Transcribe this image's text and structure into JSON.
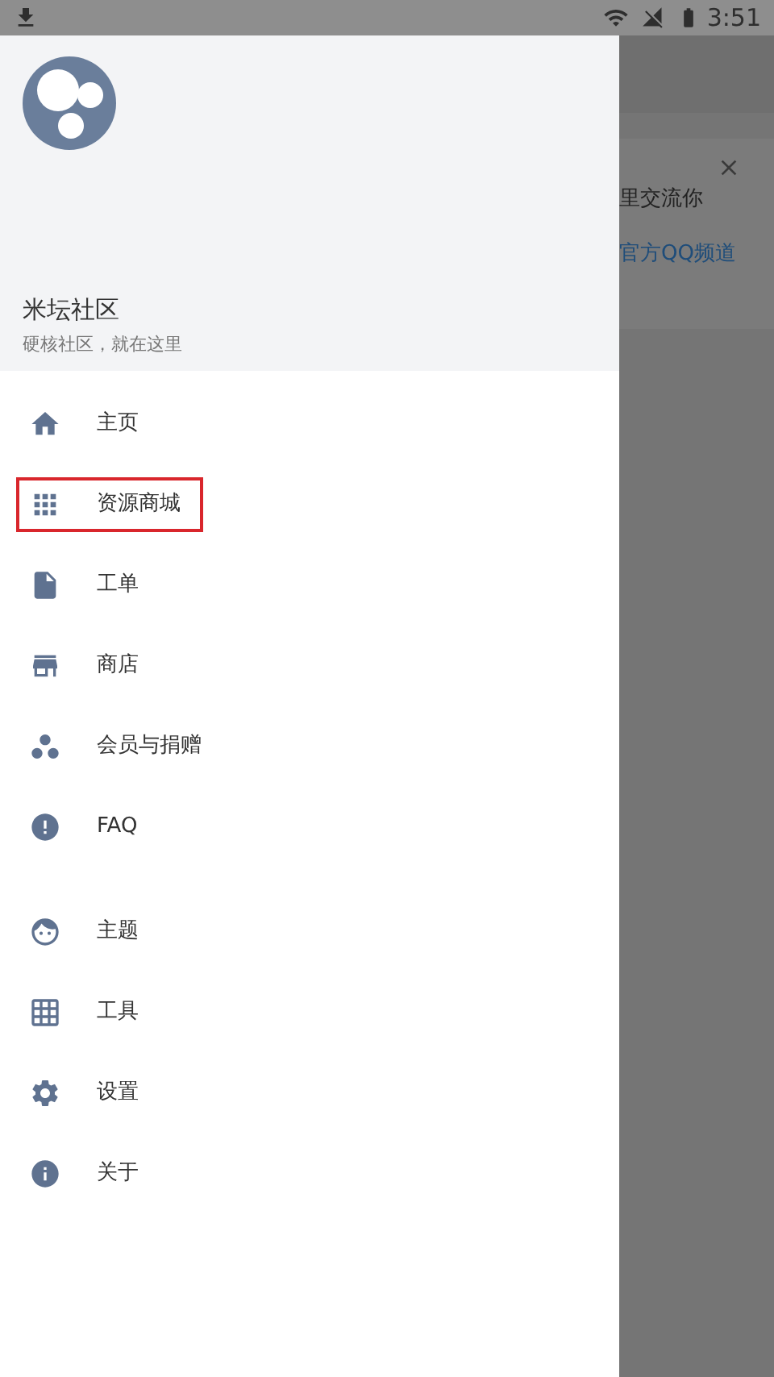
{
  "status_bar": {
    "time": "3:51"
  },
  "drawer": {
    "header": {
      "title": "米坛社区",
      "subtitle": "硬核社区，就在这里"
    },
    "sections": [
      {
        "items": [
          {
            "kind": "home",
            "label": "主页",
            "highlighted": false
          },
          {
            "kind": "apps",
            "label": "资源商城",
            "highlighted": true
          },
          {
            "kind": "file",
            "label": "工单",
            "highlighted": false
          },
          {
            "kind": "store",
            "label": "商店",
            "highlighted": false
          },
          {
            "kind": "group",
            "label": "会员与捐赠",
            "highlighted": false
          },
          {
            "kind": "alert",
            "label": "FAQ",
            "highlighted": false
          }
        ]
      },
      {
        "items": [
          {
            "kind": "face",
            "label": "主题",
            "highlighted": false
          },
          {
            "kind": "grid",
            "label": "工具",
            "highlighted": false
          },
          {
            "kind": "settings",
            "label": "设置",
            "highlighted": false
          },
          {
            "kind": "info",
            "label": "关于",
            "highlighted": false
          }
        ]
      }
    ]
  },
  "background_page": {
    "notice": {
      "text": "里交流你",
      "link": "官方QQ频道"
    }
  }
}
